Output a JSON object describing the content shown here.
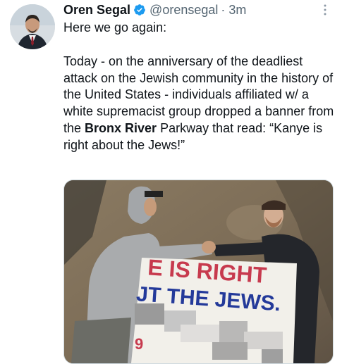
{
  "tweet": {
    "author_name": "Oren Segal",
    "handle": "@orensegal",
    "separator": "·",
    "timestamp": "3m",
    "text_line1": "Here we go again:",
    "text_p2_before": "Today - on the anniversary of the deadliest attack on the Jewish community in the history of the United States - individuals affiliated w/ a white supremacist group dropped a banner from the ",
    "text_p2_bold": "Bronx River",
    "text_p2_after": " Parkway that read: “Kanye is right about the Jews!”",
    "verified_icon": "verified-badge-icon",
    "more_icon": "more-vertical-icon",
    "accent_color": "#1d9bf0"
  },
  "media": {
    "banner_line1": "E IS RIGHT",
    "banner_line2": "JT THE JEWS."
  }
}
